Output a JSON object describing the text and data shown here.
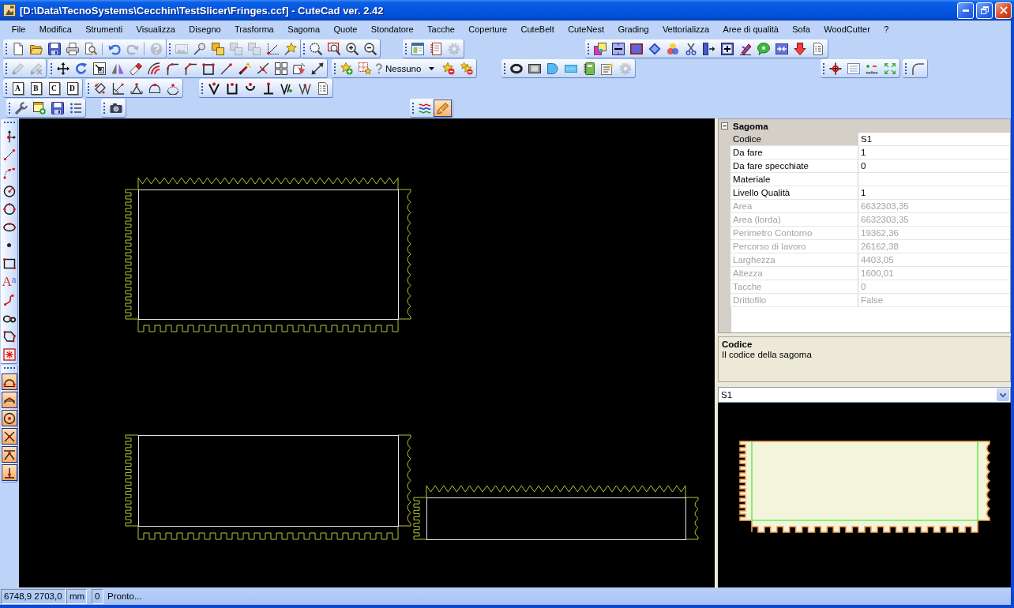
{
  "window": {
    "title": "[D:\\Data\\TecnoSystems\\Cecchin\\TestSlicer\\Fringes.ccf] - CuteCad ver. 2.42"
  },
  "menu": [
    "File",
    "Modifica",
    "Strumenti",
    "Visualizza",
    "Disegno",
    "Trasforma",
    "Sagoma",
    "Quote",
    "Stondatore",
    "Tacche",
    "Coperture",
    "CuteBelt",
    "CuteNest",
    "Grading",
    "Vettorializza",
    "Aree di qualità",
    "Sofa",
    "WoodCutter",
    "?"
  ],
  "toolbars": [
    {
      "bands": [
        {
          "items": [
            {
              "kind": "button",
              "disabled": false
            },
            {
              "kind": "button",
              "disabled": false
            },
            {
              "kind": "button",
              "disabled": false
            },
            {
              "kind": "button",
              "disabled": false
            },
            {
              "kind": "button",
              "disabled": false
            },
            {
              "kind": "separator"
            },
            {
              "kind": "button",
              "disabled": false
            },
            {
              "kind": "button",
              "disabled": true
            },
            {
              "kind": "separator"
            },
            {
              "kind": "button",
              "disabled": true
            }
          ]
        },
        {
          "items": [
            {
              "kind": "button",
              "disabled": true
            },
            {
              "kind": "button",
              "disabled": false
            },
            {
              "kind": "button",
              "disabled": false
            },
            {
              "kind": "button",
              "disabled": true
            },
            {
              "kind": "button",
              "disabled": true
            },
            {
              "kind": "button",
              "disabled": false
            },
            {
              "kind": "button",
              "disabled": false
            }
          ]
        },
        {
          "items": [
            {
              "kind": "button",
              "disabled": false
            },
            {
              "kind": "button",
              "disabled": false
            },
            {
              "kind": "button",
              "disabled": false
            },
            {
              "kind": "button",
              "disabled": false
            }
          ]
        },
        {
          "items": [
            {
              "kind": "button",
              "disabled": false
            },
            {
              "kind": "button",
              "disabled": false
            },
            {
              "kind": "button",
              "disabled": true
            }
          ]
        },
        {
          "items": [
            {
              "kind": "button",
              "disabled": false
            },
            {
              "kind": "button",
              "disabled": false
            },
            {
              "kind": "button",
              "disabled": false
            },
            {
              "kind": "button",
              "disabled": false
            },
            {
              "kind": "button",
              "disabled": false
            },
            {
              "kind": "button",
              "disabled": false
            },
            {
              "kind": "button",
              "disabled": false
            },
            {
              "kind": "button",
              "disabled": false
            },
            {
              "kind": "button",
              "disabled": false
            },
            {
              "kind": "button",
              "disabled": false
            },
            {
              "kind": "button",
              "disabled": false
            },
            {
              "kind": "button",
              "disabled": false
            },
            {
              "kind": "button",
              "disabled": false
            }
          ]
        }
      ]
    },
    {
      "bands": [
        {
          "items": [
            {
              "kind": "button",
              "disabled": true
            },
            {
              "kind": "button",
              "disabled": true
            }
          ]
        },
        {
          "items": [
            {
              "kind": "button",
              "disabled": false
            },
            {
              "kind": "button",
              "disabled": false
            },
            {
              "kind": "button",
              "disabled": false
            },
            {
              "kind": "button",
              "disabled": false
            },
            {
              "kind": "button",
              "disabled": false
            },
            {
              "kind": "button",
              "disabled": false
            },
            {
              "kind": "button",
              "disabled": false
            },
            {
              "kind": "button",
              "disabled": false
            },
            {
              "kind": "button",
              "disabled": false
            },
            {
              "kind": "button",
              "disabled": false
            },
            {
              "kind": "button",
              "disabled": false
            },
            {
              "kind": "button",
              "disabled": false
            },
            {
              "kind": "button",
              "disabled": false
            },
            {
              "kind": "button",
              "disabled": false
            },
            {
              "kind": "button",
              "disabled": false
            }
          ]
        },
        {
          "items": [
            {
              "kind": "button",
              "disabled": false
            },
            {
              "kind": "button",
              "disabled": false
            },
            {
              "kind": "dropdown",
              "value": "Nessuno"
            },
            {
              "kind": "button",
              "disabled": false
            },
            {
              "kind": "button",
              "disabled": false
            }
          ]
        },
        {
          "items": [
            {
              "kind": "button",
              "disabled": false
            },
            {
              "kind": "button",
              "disabled": false
            },
            {
              "kind": "button",
              "disabled": false
            },
            {
              "kind": "button",
              "disabled": false
            },
            {
              "kind": "button",
              "disabled": false
            },
            {
              "kind": "button",
              "disabled": false
            },
            {
              "kind": "button",
              "disabled": true
            }
          ]
        },
        {
          "items": [
            {
              "kind": "button",
              "disabled": false
            },
            {
              "kind": "button",
              "disabled": false
            },
            {
              "kind": "button",
              "disabled": false
            },
            {
              "kind": "button",
              "disabled": false
            }
          ]
        },
        {
          "items": [
            {
              "kind": "button",
              "disabled": false
            }
          ]
        }
      ]
    },
    {
      "bands": [
        {
          "items": [
            {
              "kind": "button",
              "disabled": false,
              "label": "A"
            },
            {
              "kind": "button",
              "disabled": false,
              "label": "B"
            },
            {
              "kind": "button",
              "disabled": false,
              "label": "C"
            },
            {
              "kind": "button",
              "disabled": false,
              "label": "D"
            }
          ]
        },
        {
          "items": [
            {
              "kind": "button",
              "disabled": false
            },
            {
              "kind": "button",
              "disabled": false
            },
            {
              "kind": "button",
              "disabled": false
            },
            {
              "kind": "button",
              "disabled": false
            },
            {
              "kind": "button",
              "disabled": false
            }
          ]
        },
        {
          "items": [
            {
              "kind": "button",
              "disabled": false
            },
            {
              "kind": "button",
              "disabled": false
            },
            {
              "kind": "button",
              "disabled": false
            },
            {
              "kind": "button",
              "disabled": false
            },
            {
              "kind": "button",
              "disabled": false
            },
            {
              "kind": "button",
              "disabled": false
            },
            {
              "kind": "button",
              "disabled": false
            }
          ]
        }
      ]
    },
    {
      "bands": [
        {
          "items": [
            {
              "kind": "button",
              "disabled": false
            },
            {
              "kind": "button",
              "disabled": false
            },
            {
              "kind": "button",
              "disabled": false
            },
            {
              "kind": "button",
              "disabled": false
            }
          ]
        },
        {
          "items": [
            {
              "kind": "button",
              "disabled": false
            }
          ]
        },
        {
          "items": [
            {
              "kind": "button",
              "disabled": false,
              "pressed": false
            },
            {
              "kind": "button",
              "disabled": false,
              "pressed": true
            }
          ]
        }
      ]
    }
  ],
  "draw_toolbar": {
    "items": [
      {
        "kind": "button"
      },
      {
        "kind": "button"
      },
      {
        "kind": "button"
      },
      {
        "kind": "button"
      },
      {
        "kind": "button"
      },
      {
        "kind": "button"
      },
      {
        "kind": "button"
      },
      {
        "kind": "button"
      },
      {
        "kind": "text",
        "label": "A$^{a}$"
      },
      {
        "kind": "button"
      },
      {
        "kind": "button"
      },
      {
        "kind": "button"
      },
      {
        "kind": "button"
      }
    ]
  },
  "snap_toolbar": {
    "items": [
      {
        "on": true
      },
      {
        "on": true
      },
      {
        "on": true
      },
      {
        "on": true
      },
      {
        "on": true
      },
      {
        "on": true
      }
    ]
  },
  "properties": {
    "category": "Sagoma",
    "expanded": true,
    "rows": [
      {
        "label": "Codice",
        "value": "S1",
        "selected": true,
        "readonly": false
      },
      {
        "label": "Da fare",
        "value": "1",
        "selected": false,
        "readonly": false
      },
      {
        "label": "Da fare specchiate",
        "value": "0",
        "selected": false,
        "readonly": false
      },
      {
        "label": "Materiale",
        "selected": false,
        "readonly": false
      },
      {
        "label": "Livello Qualità",
        "value": "1",
        "selected": false,
        "readonly": false
      },
      {
        "label": "Area",
        "value": "6632303,35",
        "selected": false,
        "readonly": true
      },
      {
        "label": "Area (lorda)",
        "value": "6632303,35",
        "selected": false,
        "readonly": true
      },
      {
        "label": "Perimetro Contorno",
        "value": "19362,36",
        "selected": false,
        "readonly": true
      },
      {
        "label": "Percorso di lavoro",
        "value": "26162,38",
        "selected": false,
        "readonly": true
      },
      {
        "label": "Larghezza",
        "value": "4403,05",
        "selected": false,
        "readonly": true
      },
      {
        "label": "Altezza",
        "value": "1600,01",
        "selected": false,
        "readonly": true
      },
      {
        "label": "Tacche",
        "value": "0",
        "selected": false,
        "readonly": true
      },
      {
        "label": "Drittofilo",
        "value": "False",
        "selected": false,
        "readonly": true
      }
    ]
  },
  "description": {
    "title": "Codice",
    "text": "Il codice della sagoma"
  },
  "shape_selector": {
    "value": "S1"
  },
  "status_bar": {
    "coordinates": "6748,9 2703,0",
    "units": "mm",
    "count": "0",
    "message": "Pronto..."
  }
}
